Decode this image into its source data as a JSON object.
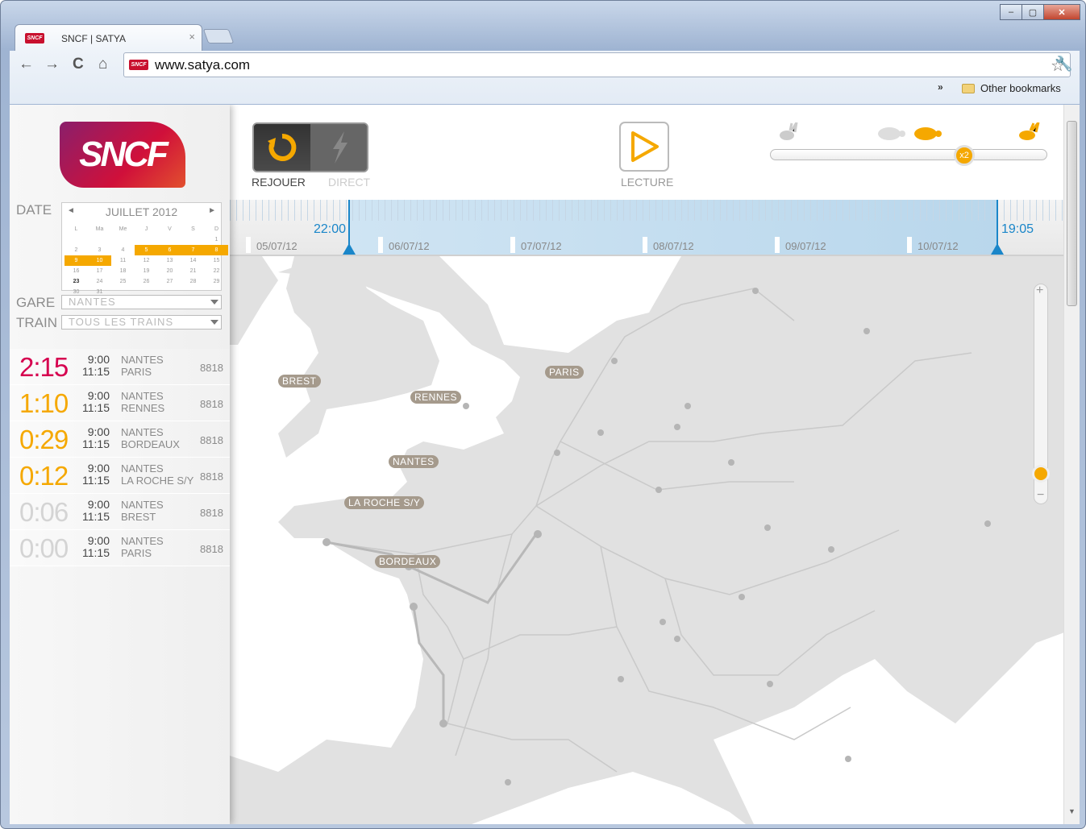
{
  "window": {
    "minimize": "–",
    "maximize": "▢",
    "close": "✕"
  },
  "tab": {
    "title": "SNCF | SATYA",
    "logo": "SNCF",
    "close": "×"
  },
  "toolbar": {
    "back": "←",
    "forward": "→",
    "reload": "C",
    "home": "⌂",
    "url": "www.satya.com",
    "star": "☆",
    "wrench": "🔧",
    "more": "»",
    "bookmarks": "Other bookmarks"
  },
  "sidebar": {
    "logo": "SNCF",
    "date_label": "DATE",
    "calendar": {
      "title": "JUILLET 2012",
      "prev": "◄",
      "next": "►",
      "weekdays": [
        "L",
        "Ma",
        "Me",
        "J",
        "V",
        "S",
        "D"
      ],
      "days": [
        "",
        "",
        "",
        "",
        "",
        "",
        "1",
        "2",
        "3",
        "4",
        "5",
        "6",
        "7",
        "8",
        "9",
        "10",
        "11",
        "12",
        "13",
        "14",
        "15",
        "16",
        "17",
        "18",
        "19",
        "20",
        "21",
        "22",
        "23",
        "24",
        "25",
        "26",
        "27",
        "28",
        "29",
        "30",
        "31"
      ]
    },
    "gare_label": "GARE",
    "gare_value": "NANTES",
    "train_label": "TRAIN",
    "train_value": "TOUS LES TRAINS",
    "trains": [
      {
        "duration": "2:15",
        "color": "#d6004f",
        "dep": "9:00",
        "arr": "11:15",
        "from": "NANTES",
        "to": "PARIS",
        "num": "8818"
      },
      {
        "duration": "1:10",
        "color": "#f5a800",
        "dep": "9:00",
        "arr": "11:15",
        "from": "NANTES",
        "to": "RENNES",
        "num": "8818"
      },
      {
        "duration": "0:29",
        "color": "#f5a800",
        "dep": "9:00",
        "arr": "11:15",
        "from": "NANTES",
        "to": "BORDEAUX",
        "num": "8818"
      },
      {
        "duration": "0:12",
        "color": "#f5a800",
        "dep": "9:00",
        "arr": "11:15",
        "from": "NANTES",
        "to": "LA ROCHE S/Y",
        "num": "8818"
      },
      {
        "duration": "0:06",
        "color": "#d4d4d4",
        "dep": "9:00",
        "arr": "11:15",
        "from": "NANTES",
        "to": "BREST",
        "num": "8818"
      },
      {
        "duration": "0:00",
        "color": "#d4d4d4",
        "dep": "9:00",
        "arr": "11:15",
        "from": "NANTES",
        "to": "PARIS",
        "num": "8818"
      }
    ]
  },
  "controls": {
    "replay_label": "REJOUER",
    "direct_label": "DIRECT",
    "play_label": "LECTURE",
    "speed": "x2"
  },
  "timeline": {
    "start_time": "22:00",
    "end_time": "19:05",
    "dates": [
      "05/07/12",
      "06/07/12",
      "07/07/12",
      "08/07/12",
      "09/07/12",
      "10/07/12"
    ]
  },
  "map": {
    "cities": [
      "BREST",
      "RENNES",
      "PARIS",
      "NANTES",
      "LA ROCHE S/Y",
      "BORDEAUX"
    ],
    "zoom_plus": "+",
    "zoom_minus": "−"
  },
  "colors": {
    "accent": "#f5a800",
    "brand": "#c8102e",
    "timeline": "#1a86c9"
  }
}
